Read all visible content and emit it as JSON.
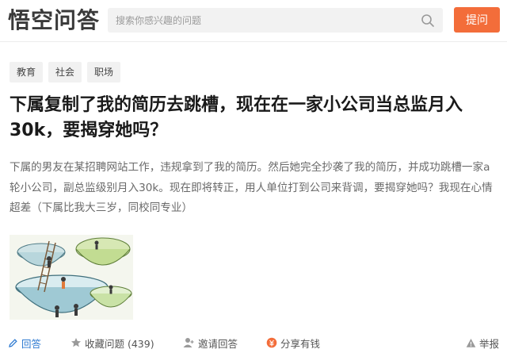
{
  "header": {
    "logo": "悟空问答",
    "search_placeholder": "搜索你感兴趣的问题",
    "ask_label": "提问"
  },
  "tags": [
    "教育",
    "社会",
    "职场"
  ],
  "question": {
    "title": "下属复制了我的简历去跳槽，现在在一家小公司当总监月入30k，要揭穿她吗？",
    "description": "下属的男友在某招聘网站工作，违规拿到了我的简历。然后她完全抄袭了我的简历，并成功跳槽一家a轮小公司，副总监级别月入30k。现在即将转正，用人单位打到公司来背调，要揭穿她吗？我现在心情超差（下属比我大三岁，同校同专业）"
  },
  "actions": {
    "answer": "回答",
    "collect": "收藏问题 (439)",
    "invite": "邀请回答",
    "share": "分享有钱",
    "report": "举报"
  },
  "colors": {
    "accent": "#f36d3a",
    "link": "#2e7ad1"
  }
}
